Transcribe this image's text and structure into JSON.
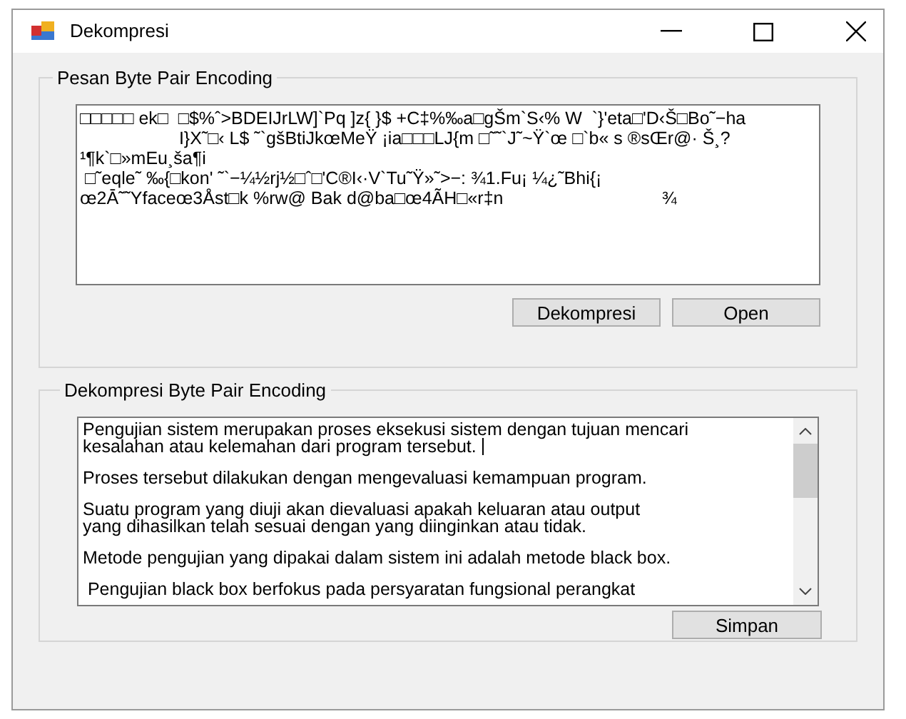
{
  "window": {
    "title": "Dekompresi"
  },
  "input_group": {
    "title": "Pesan Byte Pair Encoding",
    "text_lines": [
      "□□□□□ ek□  □$%ˆ>BDEIJrLW]`Pq ]z{ }$ +C‡%‰a□gŠm`S‹% W  `}'eta□'D‹Š□Bo˜−ha",
      "                    I}X˜□‹ L$ ˜`gšBtiJkœMeŸ ¡ia□□□LJ{m □˜˜`J˜~Ÿ`œ □`b« s ®sŒr@· Š¸?",
      "¹¶k`□»mEu¸ša¶i",
      " □˜eqle˜ ‰{□kon' ˜`−¼½rj½□ˆ□'C®I‹·V`Tu˜Ÿ»˜>−: ¾1.Fu¡ ¼¿˜Bhi{¡",
      "œ2Ā˜˜Yfaceœ3Åst□k %rw@ Bak d@ba□œ4ÃH□«r‡n                                ¾"
    ],
    "buttons": [
      "Dekompresi",
      "Open"
    ]
  },
  "output_group": {
    "title": "Dekompresi Byte Pair Encoding",
    "focused": true,
    "paragraphs": [
      [
        "Pengujian sistem merupakan proses eksekusi sistem dengan tujuan mencari",
        "kesalahan atau kelemahan dari program tersebut."
      ],
      [
        "Proses tersebut dilakukan dengan mengevaluasi kemampuan program."
      ],
      [
        "Suatu program yang diuji akan dievaluasi apakah keluaran atau output",
        "yang dihasilkan telah sesuai dengan yang diinginkan atau tidak."
      ],
      [
        "Metode pengujian yang dipakai dalam sistem ini adalah metode black box."
      ],
      [
        " Pengujian black box berfokus pada persyaratan fungsional perangkat"
      ]
    ],
    "buttons": [
      "Simpan"
    ]
  }
}
